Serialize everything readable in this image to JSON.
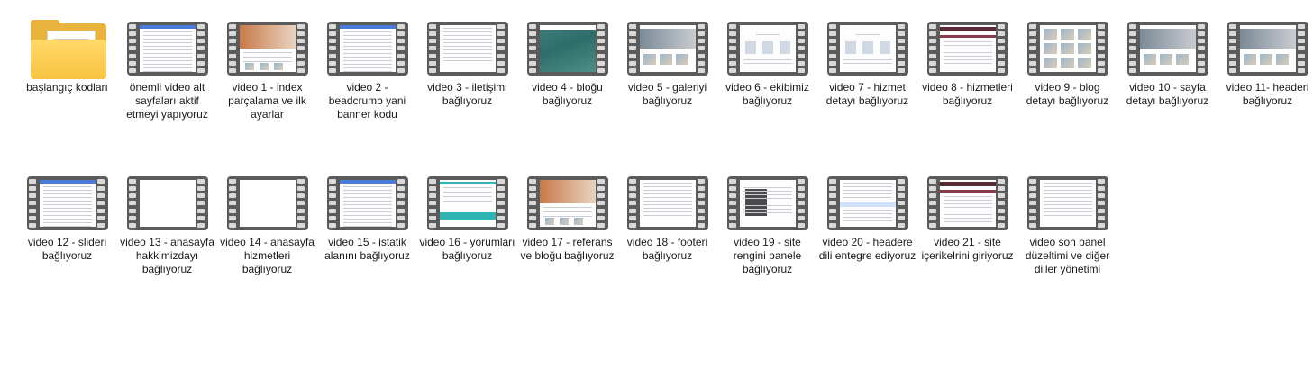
{
  "folders": [
    {
      "label": "başlangıç kodları",
      "icon": "folder-icon"
    }
  ],
  "videos_row1": [
    {
      "label": "önemli video alt sayfaları aktif etmeyi yapıyoruz",
      "preview": "list"
    },
    {
      "label": "video 1 - index parçalama ve ilk ayarlar",
      "preview": "site"
    },
    {
      "label": "video 2 - beadcrumb yani banner kodu",
      "preview": "list"
    },
    {
      "label": "video 3 - iletişimi bağlıyoruz",
      "preview": "code"
    },
    {
      "label": "video 4 - bloğu bağlıyoruz",
      "preview": "map"
    },
    {
      "label": "video 5 - galeriyi bağlıyoruz",
      "preview": "gallery"
    },
    {
      "label": "video 6 - ekibimiz bağlıyoruz",
      "preview": "team"
    },
    {
      "label": "video 7 - hizmet detayı bağlıyoruz",
      "preview": "team"
    },
    {
      "label": "video 8 - hizmetleri bağlıyoruz",
      "preview": "dark-header"
    },
    {
      "label": "video 9 - blog detayı bağlıyoruz",
      "preview": "grid"
    },
    {
      "label": "video 10 - sayfa detayı bağlıyoruz",
      "preview": "gallery"
    },
    {
      "label": "video 11- headeri bağlıyoruz",
      "preview": "gallery"
    }
  ],
  "videos_row2": [
    {
      "label": "video 12 - slideri bağlıyoruz",
      "preview": "list"
    },
    {
      "label": "video 13 - anasayfa hakkimizdayı bağlıyoruz",
      "preview": "blank"
    },
    {
      "label": "video 14 - anasayfa hizmetleri bağlıyoruz",
      "preview": "blank"
    },
    {
      "label": "video 15 - istatik alanını bağlıyoruz",
      "preview": "list"
    },
    {
      "label": "video 16 - yorumları bağlıyoruz",
      "preview": "teal"
    },
    {
      "label": "video 17 - referans ve bloğu bağlıyoruz",
      "preview": "site"
    },
    {
      "label": "video 18 - footeri bağlıyoruz",
      "preview": "code"
    },
    {
      "label": "video 19 - site rengini panele bağlıyoruz",
      "preview": "panel"
    },
    {
      "label": "video 20 - headere dili entegre ediyoruz",
      "preview": "code-blue"
    },
    {
      "label": "video 21 -  site içerikelrini giriyoruz",
      "preview": "dark-header"
    },
    {
      "label": "video son panel düzeltimi ve diğer diller yönetimi",
      "preview": "code"
    }
  ],
  "file_icon": "video-file-icon"
}
